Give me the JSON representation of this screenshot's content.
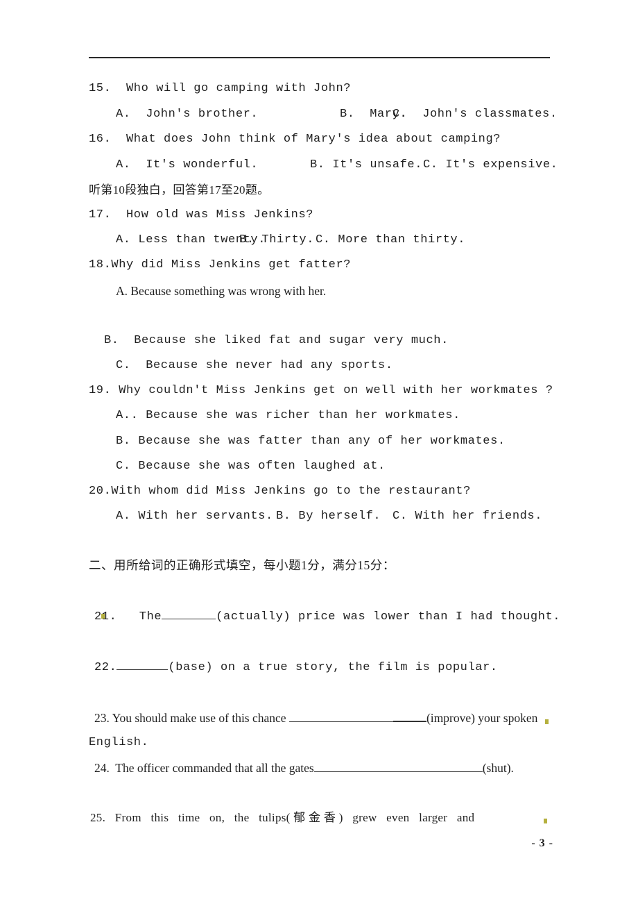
{
  "document": {
    "page_number_label": "- 3 -"
  },
  "listening_section": {
    "questions": [
      {
        "number": "15.",
        "stem": "15.  Who will go camping with John?",
        "options_inline": {
          "a": "A.  John's brother.",
          "b": "B.  Mary.",
          "c": "C.  John's classmates."
        }
      },
      {
        "number": "16.",
        "stem": "16.  What does John think of Mary's idea about camping?",
        "options_inline": {
          "a": "A.  It's wonderful.",
          "b": "B. It's unsafe.",
          "c": "C. It's expensive."
        }
      }
    ],
    "directive_cn": "听第10段独白，回答第17至20题。",
    "questions2": [
      {
        "number": "17.",
        "stem": "17.  How old was Miss Jenkins?",
        "options_inline": {
          "a": "A. Less than twenty.",
          "b": "B. Thirty.",
          "c": "C. More than thirty."
        }
      },
      {
        "number": "18.",
        "stem": "18.Why did Miss Jenkins get fatter?",
        "options_stacked": [
          "A. Because something was wrong with her.",
          "B.  Because she liked fat and sugar very much.",
          "C.  Because she never had any sports."
        ]
      },
      {
        "number": "19.",
        "stem": "19. Why couldn't Miss Jenkins get on well with her workmates ?",
        "options_stacked": [
          "A.. Because she was richer than her workmates.",
          "B. Because she was fatter than any of her workmates.",
          "C. Because she was often laughed at."
        ]
      },
      {
        "number": "20.",
        "stem": "20.With whom did Miss Jenkins go to the restaurant?",
        "options_inline": {
          "a": "A. With her servants.",
          "b": "B. By herself.",
          "c": "C. With her friends."
        }
      }
    ]
  },
  "section_two": {
    "heading_cn": "二、用所给词的正确形式填空，每小题1分，满分15分：",
    "items": [
      {
        "number": "21.",
        "prefix": "21.   The",
        "suffix": "(actually) price was lower than I had thought."
      },
      {
        "number": "22.",
        "prefix": "22.",
        "suffix": "(base) on a true story, the film is popular."
      },
      {
        "number": "23.",
        "prefix": "23. You should make use of this chance ",
        "suffix": "(improve) your spoken",
        "continuation": "English."
      },
      {
        "number": "24.",
        "prefix": "24.  The officer commanded that all the gates",
        "suffix": "(shut)."
      },
      {
        "number": "25.",
        "text": "25.   From   this   time   on,   the   tulips( 郁 金 香 )   grew   even   larger   and"
      }
    ]
  }
}
